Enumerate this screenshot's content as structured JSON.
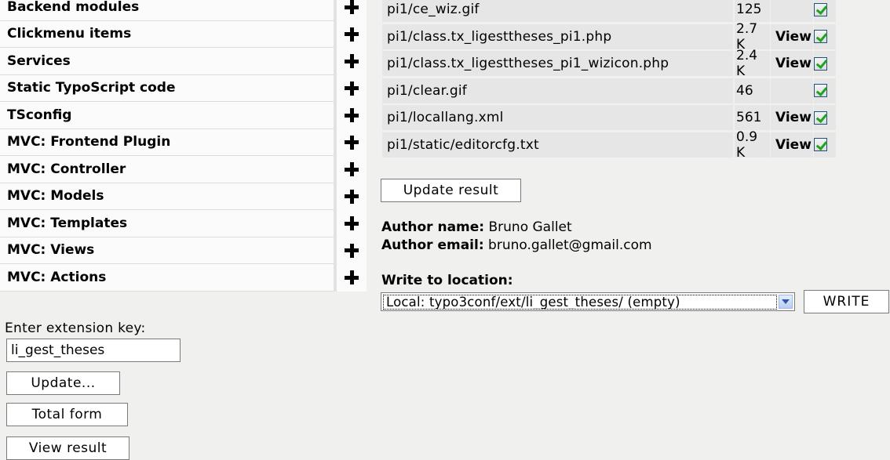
{
  "menu": {
    "items": [
      {
        "label": "Backend modules"
      },
      {
        "label": "Clickmenu items"
      },
      {
        "label": "Services"
      },
      {
        "label": "Static TypoScript code"
      },
      {
        "label": "TSconfig"
      },
      {
        "label": "MVC: Frontend Plugin"
      },
      {
        "label": "MVC: Controller"
      },
      {
        "label": "MVC: Models"
      },
      {
        "label": "MVC: Templates"
      },
      {
        "label": "MVC: Views"
      },
      {
        "label": "MVC: Actions"
      }
    ]
  },
  "extension": {
    "key_label": "Enter extension key:",
    "key_value": "li_gest_theses",
    "update_button": "Update...",
    "total_form_button": "Total form",
    "view_result_button": "View result"
  },
  "files": {
    "rows": [
      {
        "name": "pi1/ce_wiz.gif",
        "size": "125",
        "view": "",
        "checked": true
      },
      {
        "name": "pi1/class.tx_ligesttheses_pi1.php",
        "size": "2.7 K",
        "view": "View",
        "checked": true
      },
      {
        "name": "pi1/class.tx_ligesttheses_pi1_wizicon.php",
        "size": "2.4 K",
        "view": "View",
        "checked": true
      },
      {
        "name": "pi1/clear.gif",
        "size": "46",
        "view": "",
        "checked": true
      },
      {
        "name": "pi1/locallang.xml",
        "size": "561",
        "view": "View",
        "checked": true
      },
      {
        "name": "pi1/static/editorcfg.txt",
        "size": "0.9 K",
        "view": "View",
        "checked": true
      }
    ],
    "update_result_button": "Update result"
  },
  "author": {
    "name_label": "Author name:",
    "name_value": "Bruno Gallet",
    "email_label": "Author email:",
    "email_value": "bruno.gallet@gmail.com"
  },
  "location": {
    "label": "Write to location:",
    "selected": "Local: typo3conf/ext/li_gest_theses/ (empty)",
    "write_button": "WRITE"
  },
  "colors": {
    "background": "#f0f0ef",
    "row_background": "#e6e6e6",
    "check_green": "#21a121"
  }
}
